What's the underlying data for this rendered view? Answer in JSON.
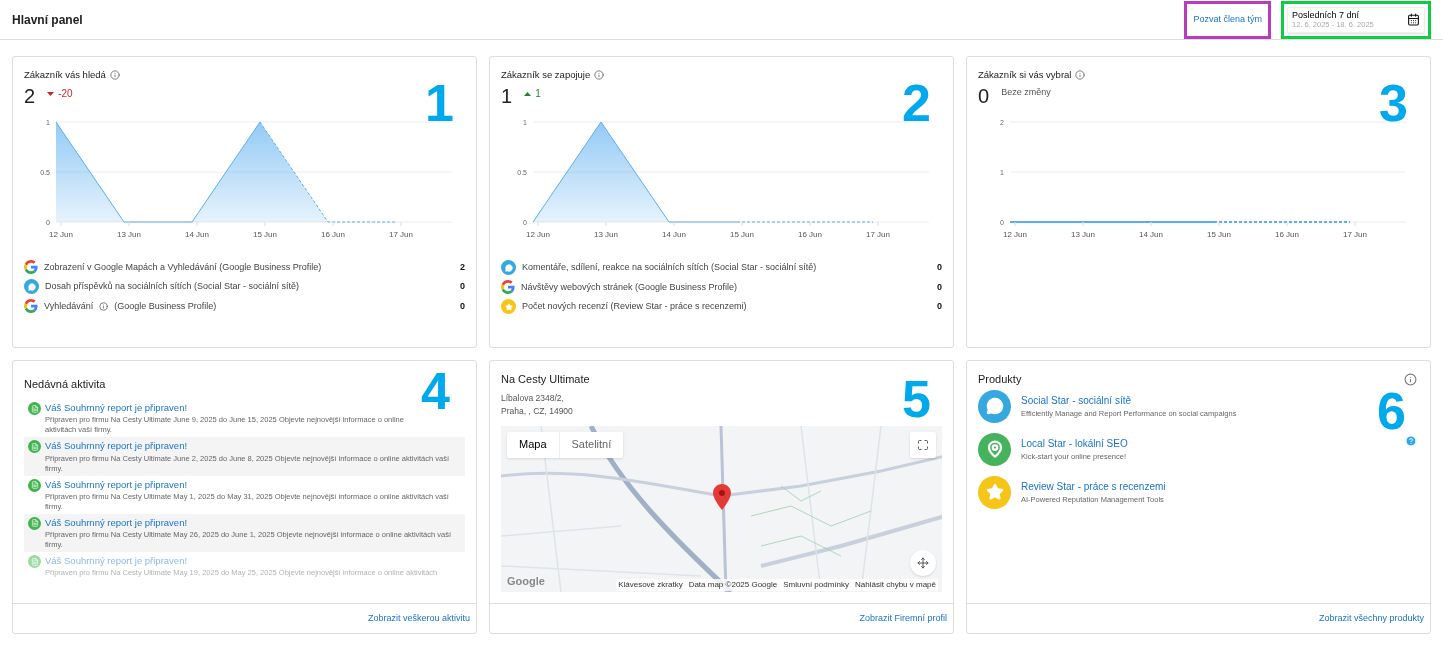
{
  "header": {
    "title": "Hlavní panel",
    "invite_link": {
      "label": "Pozvat člena tým"
    },
    "date_picker": {
      "label": "Posledních 7 dní",
      "range": "12. 6. 2025 - 18. 6. 2025"
    }
  },
  "metric_cards": [
    {
      "title": "Zákazník vás hledá",
      "value": "2",
      "kind": "down",
      "delta": "-20",
      "marker": "1",
      "chart_data": {
        "type": "area",
        "categories": [
          "12 Jun",
          "13 Jun",
          "14 Jun",
          "15 Jun",
          "16 Jun",
          "17 Jun"
        ],
        "series": [
          {
            "color": "#5aaef0",
            "line_style": "dashed",
            "values": [
              1,
              0,
              0,
              1,
              0,
              0
            ]
          }
        ],
        "ylim": [
          0,
          1
        ],
        "yticks": [
          0,
          0.5,
          1
        ]
      },
      "rows": [
        {
          "kind": "google",
          "label": "Zobrazení v Google Mapách a Vyhledávání (Google Business Profile)",
          "info": false,
          "value": "2"
        },
        {
          "kind": "social",
          "label": "Dosah příspěvků na sociálních sítích (Social Star - sociální sítě)",
          "info": false,
          "value": "0"
        },
        {
          "kind": "google",
          "label": "Vyhledávání",
          "info": true,
          "suffix": "(Google Business Profile)",
          "value": "0"
        }
      ]
    },
    {
      "title": "Zákazník se zapojuje",
      "value": "1",
      "kind": "up",
      "delta": "1",
      "marker": "2",
      "chart_data": {
        "type": "area",
        "categories": [
          "12 Jun",
          "13 Jun",
          "14 Jun",
          "15 Jun",
          "16 Jun",
          "17 Jun"
        ],
        "series": [
          {
            "color": "#5aaef0",
            "line_style": "dashed",
            "values": [
              0,
              1,
              0,
              0,
              0,
              0
            ]
          }
        ],
        "ylim": [
          0,
          1
        ],
        "yticks": [
          0,
          0.5,
          1
        ]
      },
      "rows": [
        {
          "kind": "social",
          "label": "Komentáře, sdílení, reakce na sociálních sítích (Social Star - sociální sítě)",
          "info": false,
          "value": "0"
        },
        {
          "kind": "google",
          "label": "Návštěvy webových stránek (Google Business Profile)",
          "info": false,
          "value": "0"
        },
        {
          "kind": "review",
          "label": "Počet nových recenzí (Review Star - práce s recenzemi)",
          "info": false,
          "value": "0"
        }
      ]
    },
    {
      "title": "Zákazník si vás vybral",
      "value": "0",
      "kind": "none",
      "delta": "Beze změny",
      "marker": "3",
      "chart_data": {
        "type": "line",
        "categories": [
          "12 Jun",
          "13 Jun",
          "14 Jun",
          "15 Jun",
          "16 Jun",
          "17 Jun"
        ],
        "series": [
          {
            "color": "#5aaef0",
            "line_style": "dashed",
            "values": [
              0,
              0,
              0,
              0,
              0,
              0
            ]
          }
        ],
        "ylim": [
          0,
          2
        ],
        "yticks": [
          0,
          1,
          2
        ]
      }
    }
  ],
  "activity": {
    "title": "Nedávná aktivita",
    "marker": "4",
    "footer_link": "Zobrazit veškerou aktivitu",
    "items": [
      {
        "title": "Váš Souhrnný report je připraven!",
        "text": "Připraven pro firmu Na Cesty Ultimate June 9, 2025 do June 15, 2025 Objevte nejnovější informace o online aktivitách vaší firmy."
      },
      {
        "title": "Váš Souhrnný report je připraven!",
        "text": "Připraven pro firmu Na Cesty Ultimate June 2, 2025 do June 8, 2025 Objevte nejnovější informace o online aktivitách vaší firmy."
      },
      {
        "title": "Váš Souhrnný report je připraven!",
        "text": "Připraven pro firmu Na Cesty Ultimate May 1, 2025 do May 31, 2025 Objevte nejnovější informace o online aktivitách vaší firmy."
      },
      {
        "title": "Váš Souhrnný report je připraven!",
        "text": "Připraven pro firmu Na Cesty Ultimate May 26, 2025 do June 1, 2025 Objevte nejnovější informace o online aktivitách vaší firmy."
      },
      {
        "title": "Váš Souhrnný report je připraven!",
        "text": "Připraven pro firmu Na Cesty Ultimate May 19, 2025 do May 25, 2025 Objevte nejnovější informace o online aktivitách"
      }
    ]
  },
  "business": {
    "name": "Na Cesty Ultimate",
    "address_line_1": "Líbalova 2348/2,",
    "address_line_2": "Praha, , CZ, 14900",
    "marker": "5",
    "footer_link": "Zobrazit Firemní profil",
    "map": {
      "tabs": [
        {
          "label": "Mapa",
          "selected": true
        },
        {
          "label": "Satelitní",
          "selected": false
        }
      ],
      "logo": "Google",
      "attribution": [
        "Klávesové zkratky",
        "Data map ©2025 Google",
        "Smluvní podmínky",
        "Nahlásit chybu v mapě"
      ]
    }
  },
  "products": {
    "title": "Produkty",
    "marker": "6",
    "footer_link": "Zobrazit všechny produkty",
    "items": [
      {
        "kind": "social",
        "name": "Social Star - sociální sítě",
        "description": "Efficiently Manage and Report Performance on social campaigns",
        "help": false
      },
      {
        "kind": "local",
        "name": "Local Star - lokální SEO",
        "description": "Kick-start your online presence!",
        "help": true
      },
      {
        "kind": "review",
        "name": "Review Star - práce s recenzemi",
        "description": "AI-Powered Reputation Management Tools",
        "help": false
      }
    ]
  }
}
